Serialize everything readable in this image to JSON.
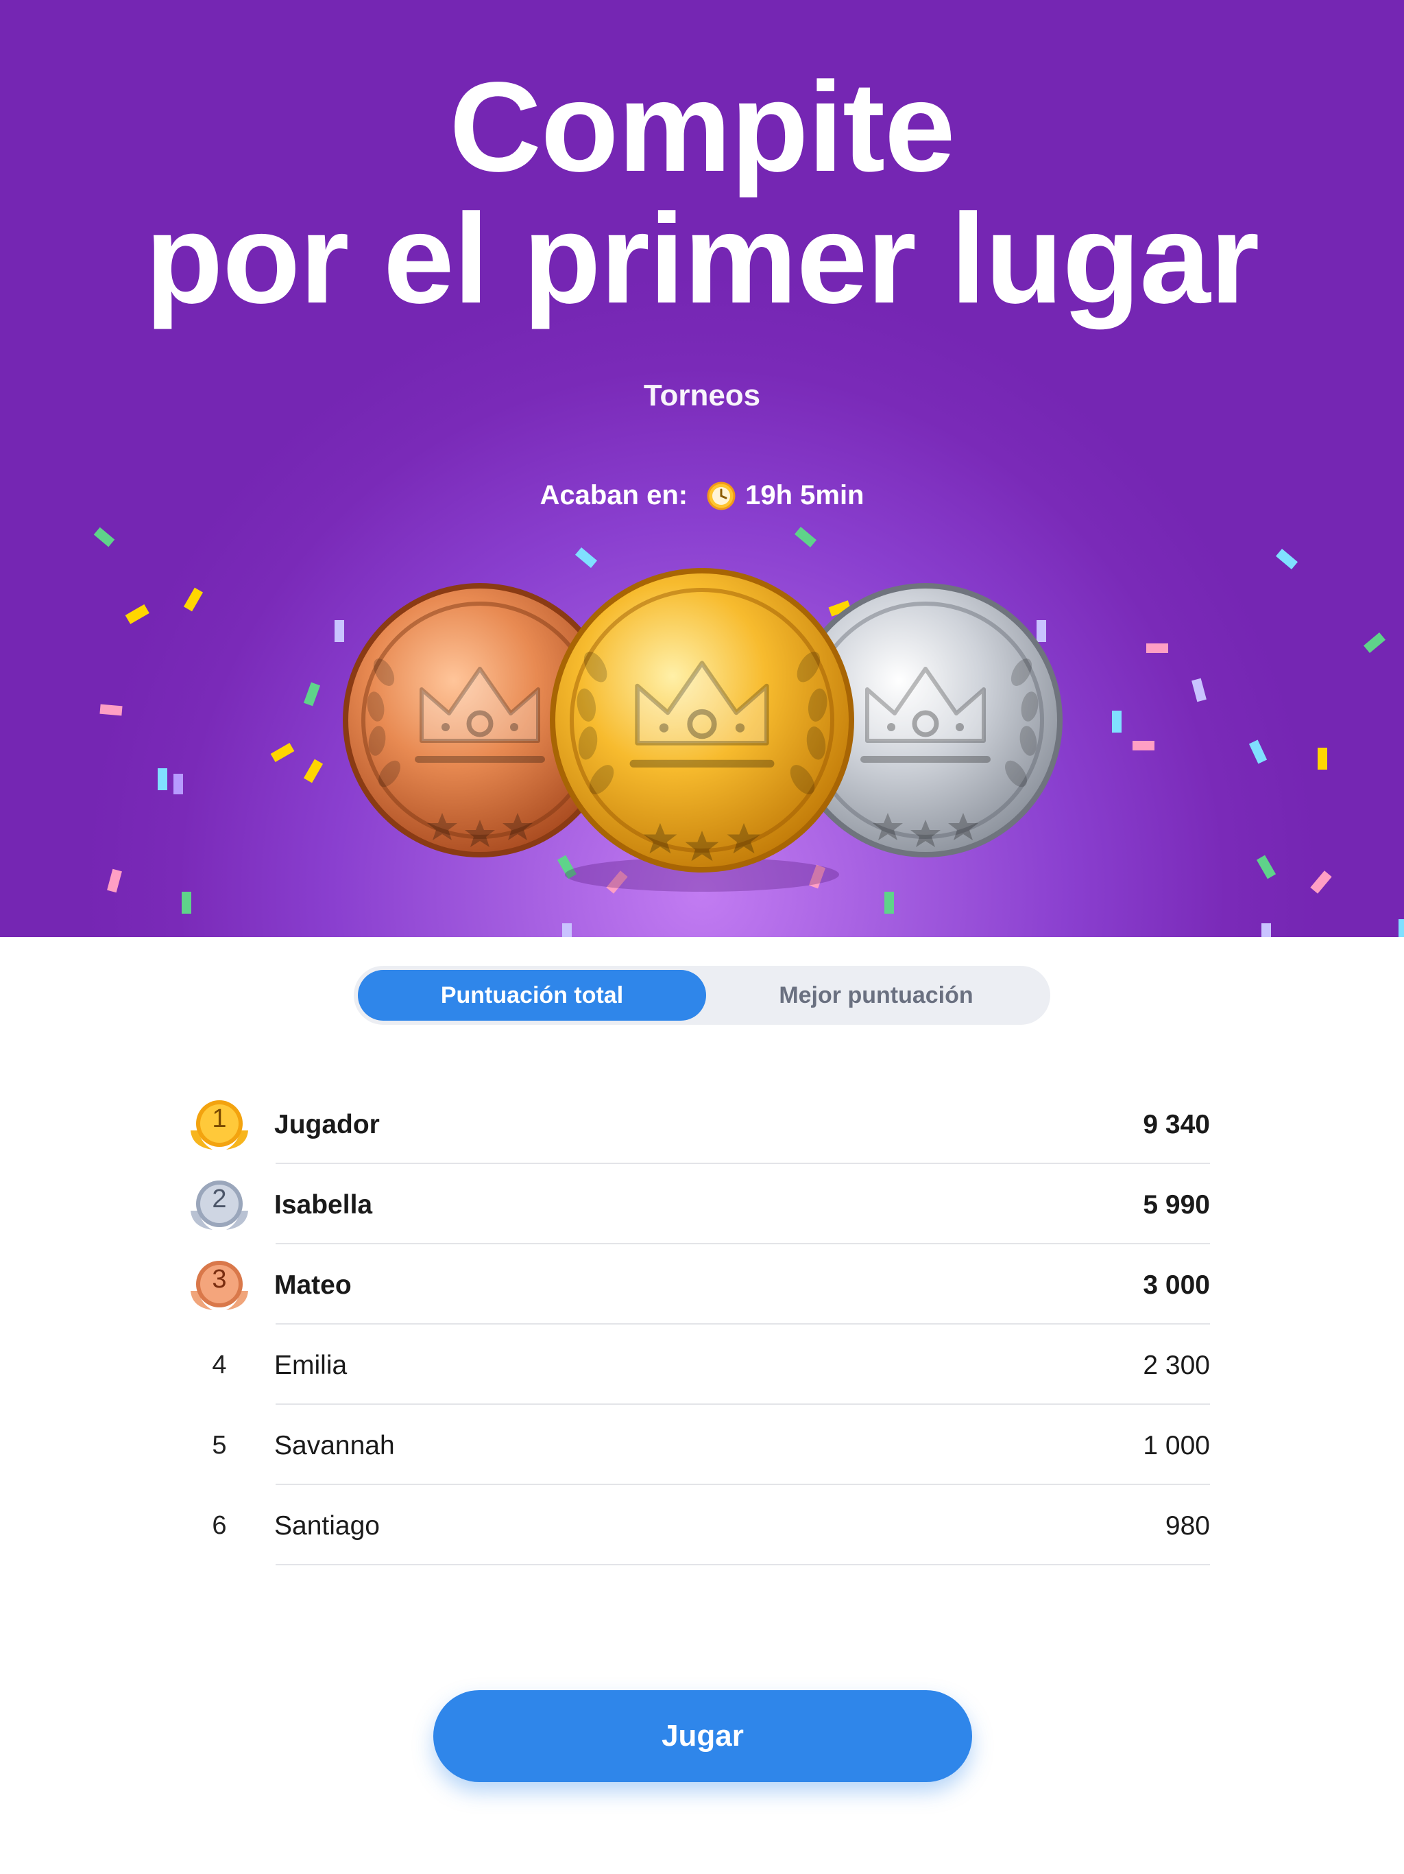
{
  "hero": {
    "title_line1": "Compite",
    "title_line2": "por el primer lugar",
    "subtitle": "Torneos",
    "ends_label": "Acaban en:",
    "ends_time": "19h 5min",
    "clock_icon": "clock-icon",
    "medals": [
      "bronze-medal-icon",
      "gold-medal-icon",
      "silver-medal-icon"
    ]
  },
  "tabs": {
    "total_score": "Puntuación total",
    "best_score": "Mejor puntuación"
  },
  "leaderboard": [
    {
      "rank": "1",
      "name": "Jugador",
      "score": "9 340",
      "badge": "gold"
    },
    {
      "rank": "2",
      "name": "Isabella",
      "score": "5 990",
      "badge": "silver"
    },
    {
      "rank": "3",
      "name": "Mateo",
      "score": "3 000",
      "badge": "bronze"
    },
    {
      "rank": "4",
      "name": "Emilia",
      "score": "2 300"
    },
    {
      "rank": "5",
      "name": "Savannah",
      "score": "1 000"
    },
    {
      "rank": "6",
      "name": "Santiago",
      "score": "980"
    }
  ],
  "play_button": "Jugar",
  "colors": {
    "hero_purple": "#7a2ab8",
    "accent_blue": "#2f86ea",
    "gold": "#f5b21e",
    "silver": "#b9c2d3",
    "bronze": "#e48c5c"
  }
}
